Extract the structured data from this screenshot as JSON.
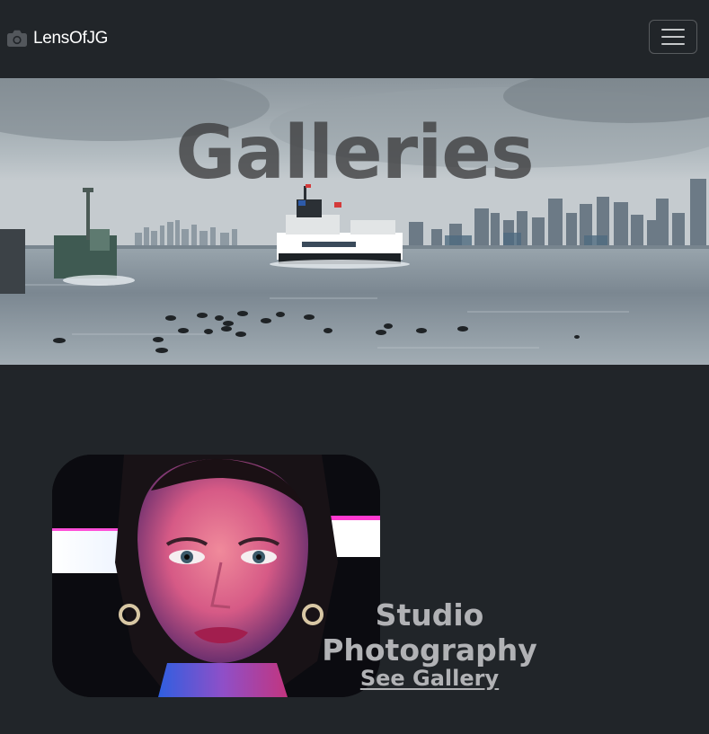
{
  "navbar": {
    "brand_icon": "camera-icon",
    "brand_text": "LensOfJG",
    "toggler_icon": "hamburger-menu-icon"
  },
  "hero": {
    "title": "Galleries"
  },
  "galleries": [
    {
      "title": "Studio Photography",
      "link_label": "See Gallery"
    }
  ],
  "colors": {
    "background": "#212529",
    "navbar": "#212529",
    "brand_text": "#ffffff",
    "hero_title": "#4a4a4c",
    "card_text": "#b1b2b5"
  }
}
